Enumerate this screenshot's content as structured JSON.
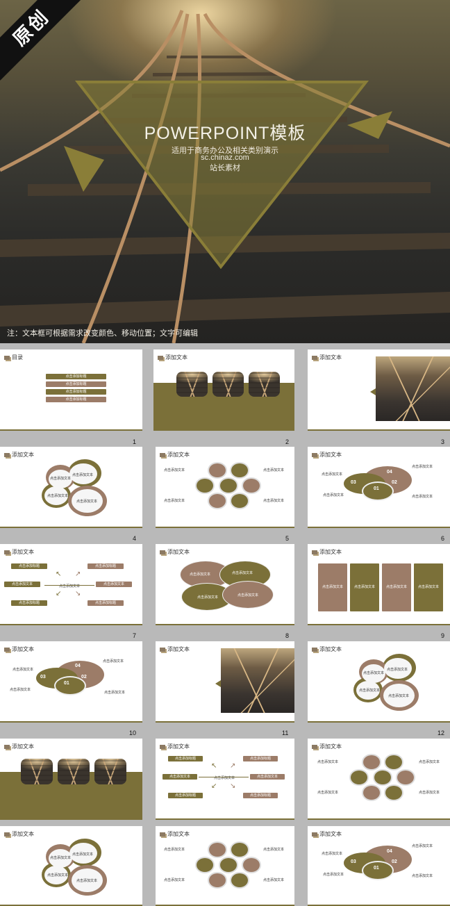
{
  "hero": {
    "badge": "原创",
    "title": "POWERPOINT模板",
    "sub1": "适用于商务办公及相关类别演示",
    "sub2": "sc.chinaz.com",
    "sub3": "站长素材",
    "note": "注：文本框可根据需求改变颜色、移动位置；文字可编辑"
  },
  "slides": {
    "toc": "目录",
    "add_text": "添加文本",
    "click_add": "点击添加标题",
    "click_text": "点击添加文本",
    "n01": "01",
    "n02": "02",
    "n03": "03",
    "n04": "04"
  },
  "numbers": [
    "1",
    "2",
    "3",
    "4",
    "5",
    "6",
    "7",
    "8",
    "9",
    "10",
    "11",
    "12"
  ],
  "colors": {
    "olive": "#7b7039",
    "brown": "#9c7c68",
    "bg": "#b9b9b9"
  }
}
